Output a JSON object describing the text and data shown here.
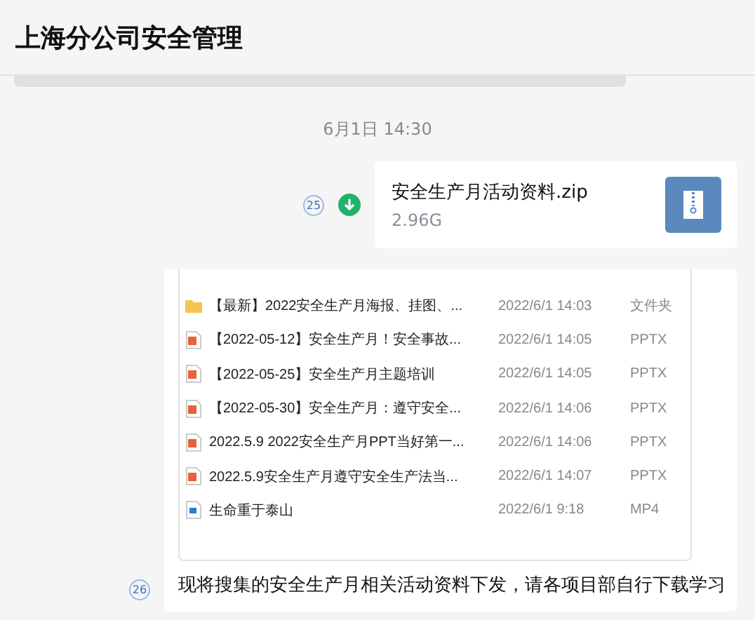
{
  "window": {
    "title": "上海分公司安全管理"
  },
  "messages": [
    {
      "kind": "time",
      "text": "6月1日 14:30"
    },
    {
      "kind": "file",
      "read_count": "25",
      "file_name": "安全生产月活动资料.zip",
      "size": "2.96G"
    },
    {
      "kind": "screenshot",
      "read_count": "26",
      "rows": [
        {
          "kind": "folder",
          "name": "【最新】2022安全生产月海报、挂图、...",
          "date": "2022/6/1 14:03",
          "type": "文件夹"
        },
        {
          "kind": "pptx",
          "name": "【2022-05-12】安全生产月！安全事故...",
          "date": "2022/6/1 14:05",
          "type": "PPTX"
        },
        {
          "kind": "pptx",
          "name": "【2022-05-25】安全生产月主题培训",
          "date": "2022/6/1 14:05",
          "type": "PPTX"
        },
        {
          "kind": "pptx",
          "name": "【2022-05-30】安全生产月：遵守安全...",
          "date": "2022/6/1 14:06",
          "type": "PPTX"
        },
        {
          "kind": "pptx",
          "name": "2022.5.9 2022安全生产月PPT当好第一...",
          "date": "2022/6/1 14:06",
          "type": "PPTX"
        },
        {
          "kind": "pptx",
          "name": "2022.5.9安全生产月遵守安全生产法当...",
          "date": "2022/6/1 14:07",
          "type": "PPTX"
        },
        {
          "kind": "video",
          "name": "生命重于泰山",
          "date": "2022/6/1 9:18",
          "type": "MP4"
        }
      ],
      "caption": "现将搜集的安全生产月相关活动资料下发，请各项目部自行下载学习"
    }
  ]
}
